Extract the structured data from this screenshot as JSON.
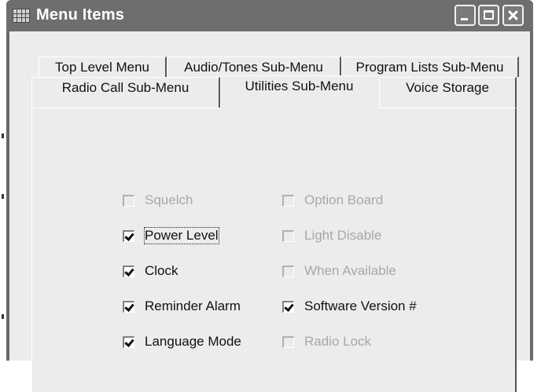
{
  "window": {
    "title": "Menu Items"
  },
  "tabs_row1": [
    {
      "label": "Top Level Menu"
    },
    {
      "label": "Audio/Tones Sub-Menu"
    },
    {
      "label": "Program Lists Sub-Menu"
    }
  ],
  "tabs_row2": [
    {
      "label": "Radio Call Sub-Menu"
    },
    {
      "label": "Utilities Sub-Menu",
      "selected": true
    },
    {
      "label": "Voice Storage"
    }
  ],
  "options_left": [
    {
      "label": "Squelch",
      "checked": false,
      "enabled": false
    },
    {
      "label": "Power Level",
      "checked": true,
      "enabled": true,
      "focused": true
    },
    {
      "label": "Clock",
      "checked": true,
      "enabled": true
    },
    {
      "label": "Reminder Alarm",
      "checked": true,
      "enabled": true
    },
    {
      "label": "Language Mode",
      "checked": true,
      "enabled": true
    }
  ],
  "options_right": [
    {
      "label": "Option Board",
      "checked": false,
      "enabled": false
    },
    {
      "label": "Light Disable",
      "checked": false,
      "enabled": false
    },
    {
      "label": "When Available",
      "checked": false,
      "enabled": false
    },
    {
      "label": "Software Version #",
      "checked": true,
      "enabled": true
    },
    {
      "label": "Radio Lock",
      "checked": false,
      "enabled": false
    }
  ]
}
